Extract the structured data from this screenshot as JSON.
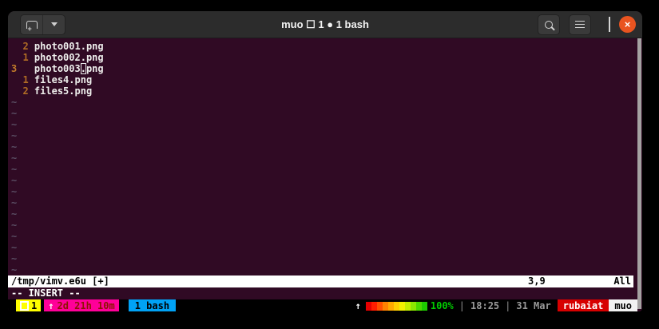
{
  "titlebar": {
    "title": "muo ☐ 1 ● 1 bash",
    "icons": {
      "new_tab": "tab-with-plus",
      "tab_dropdown": "chevron-down",
      "search": "magnifier",
      "menu": "hamburger",
      "minimize": "dash",
      "maximize": "square",
      "close": "×"
    }
  },
  "editor": {
    "lines": [
      {
        "num": "2",
        "text": "photo001.png"
      },
      {
        "num": "1",
        "text": "photo002.png"
      },
      {
        "num": "3",
        "text": "photo003.png",
        "current": true,
        "cursor_col": 9
      },
      {
        "num": "1",
        "text": "files4.png"
      },
      {
        "num": "2",
        "text": "files5.png"
      }
    ],
    "tilde_symbol": "~",
    "tilde_count": 16,
    "statusline": {
      "file": "/tmp/vimv.e6u [+]",
      "position": "3,9",
      "scroll": "All"
    },
    "mode_message": "-- INSERT --"
  },
  "tmux": {
    "session": {
      "label": "1"
    },
    "uptime": {
      "arrow": "↑",
      "text": "2d 21h 10m"
    },
    "window_tab": "1 bash",
    "right": {
      "arrow": "↑",
      "battery_gradient": [
        "#e60000",
        "#ff1e00",
        "#ff5000",
        "#ff8200",
        "#ffaa00",
        "#ffcf00",
        "#f2f200",
        "#c3ef00",
        "#8ce600",
        "#4cd800",
        "#1ecb00"
      ],
      "battery_percent": "100%",
      "separator": "|",
      "time": "18:25",
      "date": "31 Mar",
      "user": "rubaiat",
      "host": "muo"
    }
  },
  "colors": {
    "terminal_bg": "#300a24",
    "titlebar_bg": "#2c2c2c",
    "close_button": "#e95420",
    "line_number": "#b06c25",
    "session_yellow": "#ffff00",
    "uptime_magenta": "#ff0098",
    "window_blue": "#00a2f5",
    "user_red": "#d70000",
    "battery_green": "#00cc00"
  }
}
